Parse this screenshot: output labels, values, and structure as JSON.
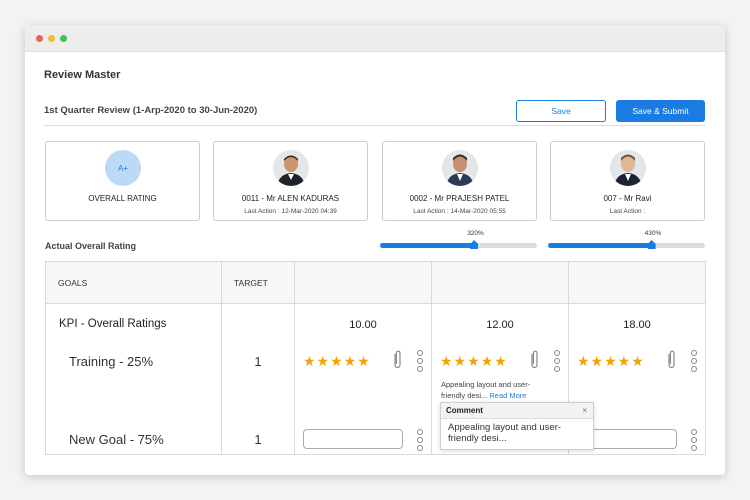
{
  "window": {
    "dots": [
      "#ed5f57",
      "#f5bd2e",
      "#39c74a"
    ]
  },
  "page": {
    "title": "Review Master",
    "review_period": "1st Quarter Review (1-Arp-2020 to 30-Jun-2020)",
    "save_label": "Save",
    "save_submit_label": "Save & Submit"
  },
  "overall_card": {
    "badge": "A+",
    "label": "OVERALL RATING"
  },
  "employees": [
    {
      "name": "0011 - Mr ALEN KADURAS",
      "last_action": "Last Action : 12-Mar-2020 04:39"
    },
    {
      "name": "0002 - Mr PRAJESH PATEL",
      "last_action": "Last Action : 14-Mar-2020 05:55"
    },
    {
      "name": "007 - Mr Ravi",
      "last_action": "Last Action :"
    }
  ],
  "actual_rating": {
    "label": "Actual Overall Rating",
    "sliders": [
      {
        "value_label": "320%",
        "fill_fraction": 0.6
      },
      {
        "value_label": "430%",
        "fill_fraction": 0.66
      }
    ]
  },
  "table": {
    "col_goals": "GOALS",
    "col_target": "TARGET",
    "kpi_label": "KPI - Overall Ratings",
    "goals": [
      {
        "name": "Training - 25%",
        "target": "1"
      },
      {
        "name": "New Goal - 75%",
        "target": "1"
      }
    ],
    "scores": [
      "10.00",
      "12.00",
      "18.00"
    ],
    "stars": "★★★★★",
    "comment_preview": "Appealing layout and user-friendly desi...",
    "read_more": "Read More"
  },
  "comment_popup": {
    "title": "Comment",
    "close": "×",
    "text": "Appealing layout and user-friendly desi..."
  },
  "icons": [
    "paperclip-icon",
    "more-vertical-icon",
    "close-icon"
  ]
}
